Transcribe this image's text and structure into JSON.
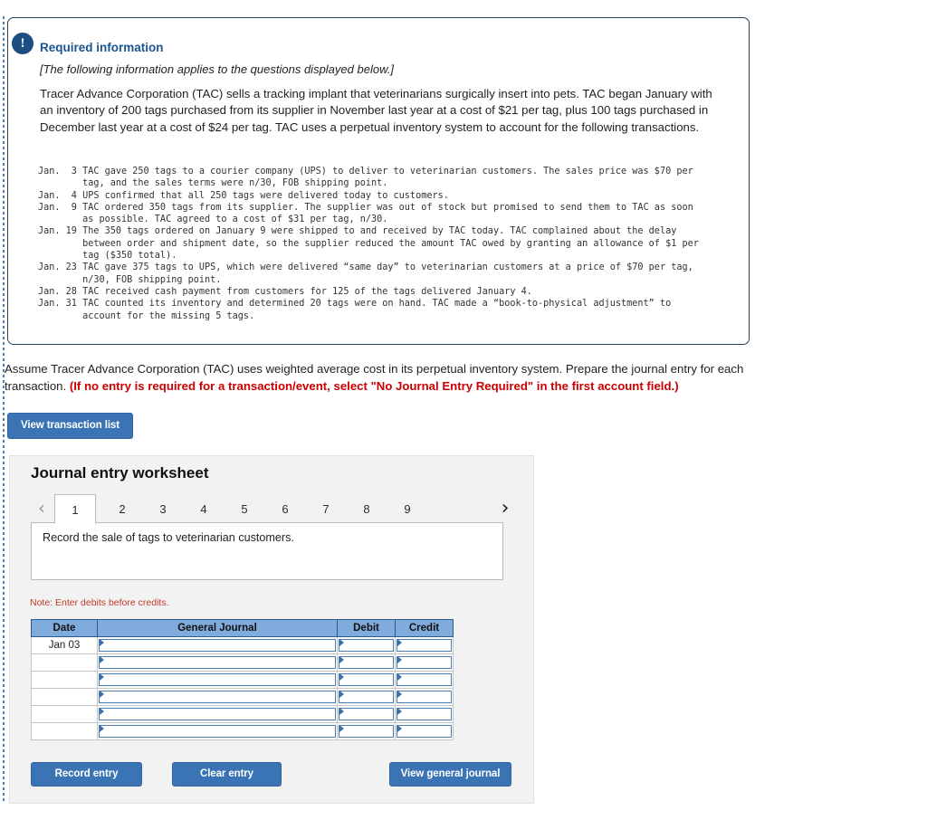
{
  "alert": {
    "icon": "exclamation-icon",
    "glyph": "!"
  },
  "required_info": {
    "title": "Required information",
    "subtitle": "[The following information applies to the questions displayed below.]",
    "body": "Tracer Advance Corporation (TAC) sells a tracking implant that veterinarians surgically insert into pets. TAC began January with an inventory of 200 tags purchased from its supplier in November last year at a cost of $21 per tag, plus 100 tags purchased in December last year at a cost of $24 per tag. TAC uses a perpetual inventory system to account for the following transactions.",
    "transactions": "Jan.  3 TAC gave 250 tags to a courier company (UPS) to deliver to veterinarian customers. The sales price was $70 per\n        tag, and the sales terms were n/30, FOB shipping point.\nJan.  4 UPS confirmed that all 250 tags were delivered today to customers.\nJan.  9 TAC ordered 350 tags from its supplier. The supplier was out of stock but promised to send them to TAC as soon\n        as possible. TAC agreed to a cost of $31 per tag, n/30.\nJan. 19 The 350 tags ordered on January 9 were shipped to and received by TAC today. TAC complained about the delay\n        between order and shipment date, so the supplier reduced the amount TAC owed by granting an allowance of $1 per\n        tag ($350 total).\nJan. 23 TAC gave 375 tags to UPS, which were delivered “same day” to veterinarian customers at a price of $70 per tag,\n        n/30, FOB shipping point.\nJan. 28 TAC received cash payment from customers for 125 of the tags delivered January 4.\nJan. 31 TAC counted its inventory and determined 20 tags were on hand. TAC made a “book-to-physical adjustment” to\n        account for the missing 5 tags."
  },
  "prompt": {
    "text": "Assume Tracer Advance Corporation (TAC) uses weighted average cost in its perpetual inventory system. Prepare the journal entry for each transaction. ",
    "highlight": "(If no entry is required for a transaction/event, select \"No Journal Entry Required\" in the first account field.)",
    "highlight_color": "#cc0000"
  },
  "buttons": {
    "view_transaction_list": "View transaction list",
    "record_entry": "Record entry",
    "clear_entry": "Clear entry",
    "view_general_journal": "View general journal",
    "primary_color": "#3b74b5"
  },
  "worksheet": {
    "title": "Journal entry worksheet",
    "tabs": [
      "1",
      "2",
      "3",
      "4",
      "5",
      "6",
      "7",
      "8",
      "9"
    ],
    "active_tab": "1",
    "prev_arrow": "‹",
    "next_arrow": "›",
    "description": "Record the sale of tags to veterinarian customers.",
    "note": "Note: Enter debits before credits.",
    "table": {
      "headers": [
        "Date",
        "General Journal",
        "Debit",
        "Credit"
      ],
      "header_color": "#7fabdd",
      "rows": [
        {
          "date": "Jan 03",
          "account": "",
          "debit": "",
          "credit": ""
        },
        {
          "date": "",
          "account": "",
          "debit": "",
          "credit": ""
        },
        {
          "date": "",
          "account": "",
          "debit": "",
          "credit": ""
        },
        {
          "date": "",
          "account": "",
          "debit": "",
          "credit": ""
        },
        {
          "date": "",
          "account": "",
          "debit": "",
          "credit": ""
        },
        {
          "date": "",
          "account": "",
          "debit": "",
          "credit": ""
        }
      ]
    }
  }
}
